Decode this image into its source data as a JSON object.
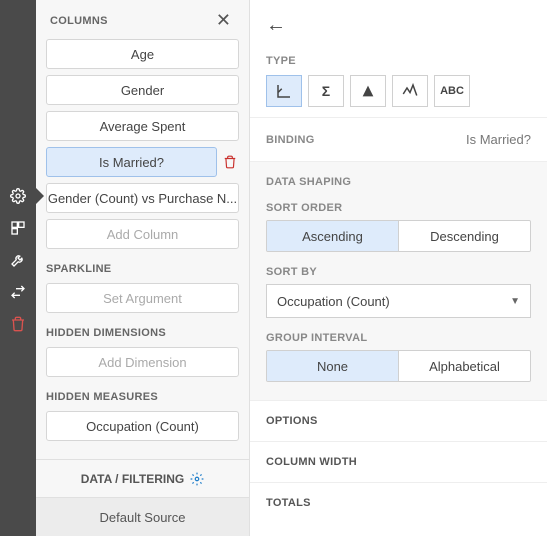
{
  "toolbar": {
    "items": [
      "gear",
      "layout",
      "wrench",
      "swap",
      "trash"
    ]
  },
  "columnsPanel": {
    "title": "COLUMNS",
    "items": [
      {
        "label": "Age",
        "selected": false
      },
      {
        "label": "Gender",
        "selected": false
      },
      {
        "label": "Average Spent",
        "selected": false
      },
      {
        "label": "Is Married?",
        "selected": true,
        "deletable": true
      },
      {
        "label": "Gender (Count) vs Purchase N...",
        "selected": false
      }
    ],
    "addColumn": "Add Column",
    "sparklineTitle": "SPARKLINE",
    "sparklineAction": "Set Argument",
    "hiddenDimTitle": "HIDDEN DIMENSIONS",
    "hiddenDimAction": "Add Dimension",
    "hiddenMeasTitle": "HIDDEN MEASURES",
    "hiddenMeasures": [
      "Occupation (Count)"
    ],
    "dataFiltering": "DATA / FILTERING",
    "defaultSource": "Default Source"
  },
  "detail": {
    "typeLabel": "TYPE",
    "types": [
      "dimension",
      "sigma",
      "delta",
      "spark",
      "abc"
    ],
    "typeSelected": 0,
    "bindingLabel": "BINDING",
    "bindingValue": "Is Married?",
    "dataShapingTitle": "DATA SHAPING",
    "sortOrderLabel": "SORT ORDER",
    "sortOrder": {
      "options": [
        "Ascending",
        "Descending"
      ],
      "selected": 0
    },
    "sortByLabel": "SORT BY",
    "sortByValue": "Occupation (Count)",
    "groupIntervalLabel": "GROUP INTERVAL",
    "groupInterval": {
      "options": [
        "None",
        "Alphabetical"
      ],
      "selected": 0
    },
    "accordion": [
      "OPTIONS",
      "COLUMN WIDTH",
      "TOTALS"
    ]
  }
}
